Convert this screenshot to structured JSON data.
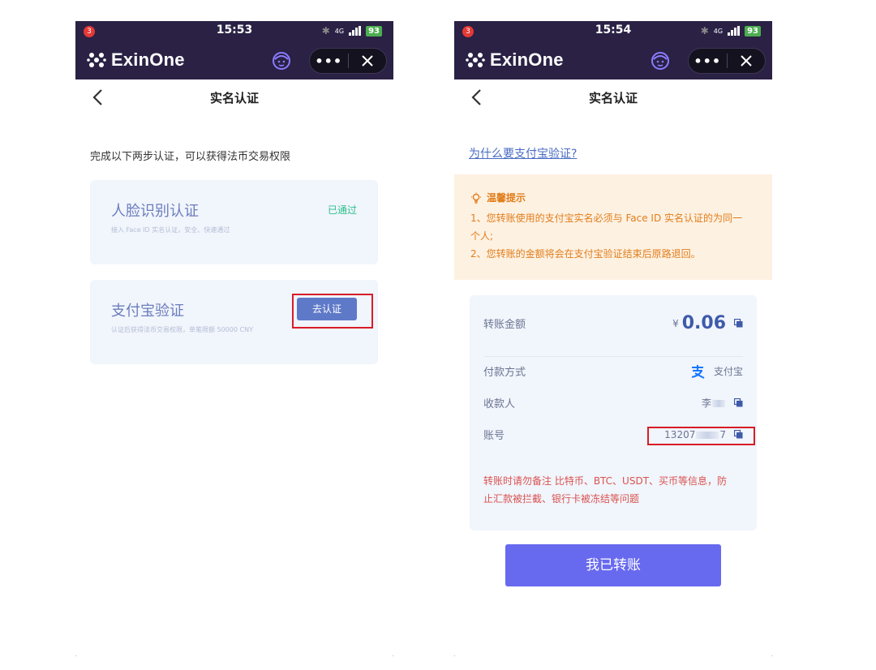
{
  "status_bar_left": {
    "notification_count": "3",
    "time": "15:53",
    "network": "4G",
    "battery": "93"
  },
  "status_bar_right": {
    "notification_count": "3",
    "time": "15:54",
    "network": "4G",
    "battery": "93"
  },
  "app": {
    "title": "ExinOne",
    "more_icon": "more-icon",
    "close_icon": "close-icon",
    "face_icon": "support-face-icon"
  },
  "nav": {
    "title": "实名认证",
    "back_icon": "back-chevron-icon"
  },
  "left": {
    "intro": "完成以下两步认证，可以获得法币交易权限",
    "face_card": {
      "title": "人脸识别认证",
      "desc": "接入 Face ID 实名认证，安全、快速通过",
      "status": "已通过"
    },
    "alipay_card": {
      "title": "支付宝验证",
      "desc": "认证后获得法币交易权限，单笔限额 50000 CNY",
      "button": "去认证"
    }
  },
  "right": {
    "why_link": "为什么要支付宝验证?",
    "tips": {
      "title": "温馨提示",
      "line1": "1、您转账使用的支付宝实名必须与 Face ID 实名认证的为同一",
      "line2": "个人;",
      "line3": "2、您转账的金额将会在支付宝验证结束后原路退回。"
    },
    "transfer": {
      "amount_label": "转账金额",
      "currency_symbol": "¥",
      "amount_value": "0.06",
      "method_label": "付款方式",
      "method_value": "支付宝",
      "payee_label": "收款人",
      "payee_value_prefix": "李",
      "account_label": "账号",
      "account_value_prefix": "13207",
      "account_value_suffix": "7",
      "warning_line1": "转账时请勿备注 比特币、BTC、USDT、买币等信息，防",
      "warning_line2": "止汇款被拦截、银行卡被冻结等问题"
    },
    "confirm_button": "我已转账"
  },
  "colors": {
    "header_bg": "#2a2145",
    "accent": "#5e79c8",
    "primary_button": "#6769ef",
    "success": "#2bbf8a",
    "highlight_border": "#d81c27",
    "tips_text": "#e27d1a",
    "warning_text": "#d9534f"
  }
}
